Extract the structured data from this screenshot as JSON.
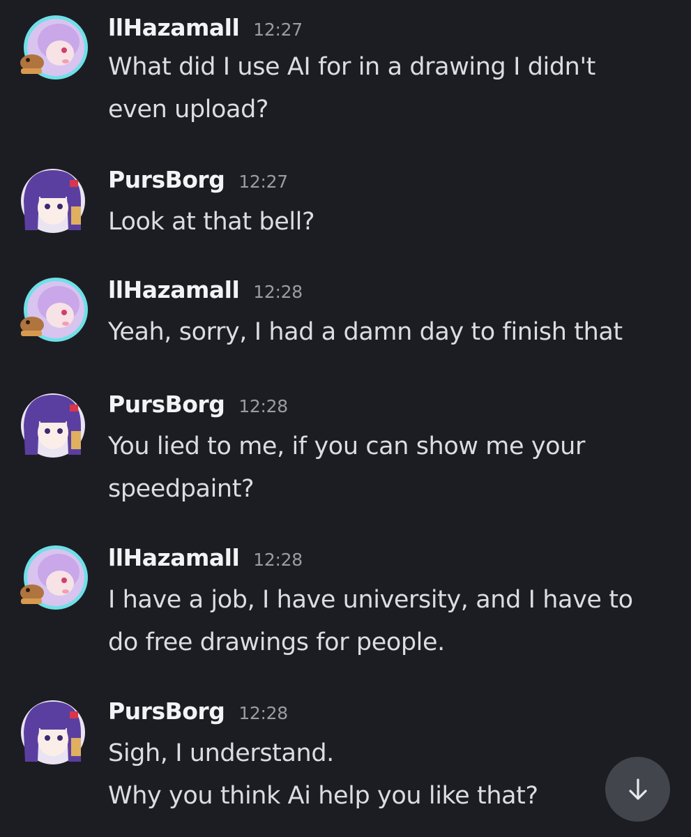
{
  "users": {
    "hazama": {
      "name": "llHazamall",
      "avatar_icon": "anime-girl-with-capybara-avatar",
      "frame_color": "#6ee0e8"
    },
    "purs": {
      "name": "PursBorg",
      "avatar_icon": "anime-girl-purple-hair-avatar"
    }
  },
  "messages": [
    {
      "user": "llHazamall",
      "time": "12:27",
      "lines": [
        "What did I use AI for in a drawing I didn't",
        "even upload?"
      ]
    },
    {
      "user": "PursBorg",
      "time": "12:27",
      "lines": [
        "Look at that bell?"
      ]
    },
    {
      "user": "llHazamall",
      "time": "12:28",
      "lines": [
        "Yeah, sorry, I had a damn day to finish that"
      ]
    },
    {
      "user": "PursBorg",
      "time": "12:28",
      "lines": [
        "You lied to me, if you can show me your",
        "speedpaint?"
      ]
    },
    {
      "user": "llHazamall",
      "time": "12:28",
      "lines": [
        "I have a job, I have university, and I have to",
        "do free drawings for people."
      ]
    },
    {
      "user": "PursBorg",
      "time": "12:28",
      "lines": [
        "Sigh, I understand.",
        "Why you think Ai help you like that?"
      ]
    }
  ],
  "scroll_button": {
    "icon": "arrow-down-icon"
  },
  "colors": {
    "background": "#1c1d22",
    "username": "#f2f3f5",
    "text": "#dcdde1",
    "timestamp": "#9a9ca3",
    "button": "#43454d"
  }
}
